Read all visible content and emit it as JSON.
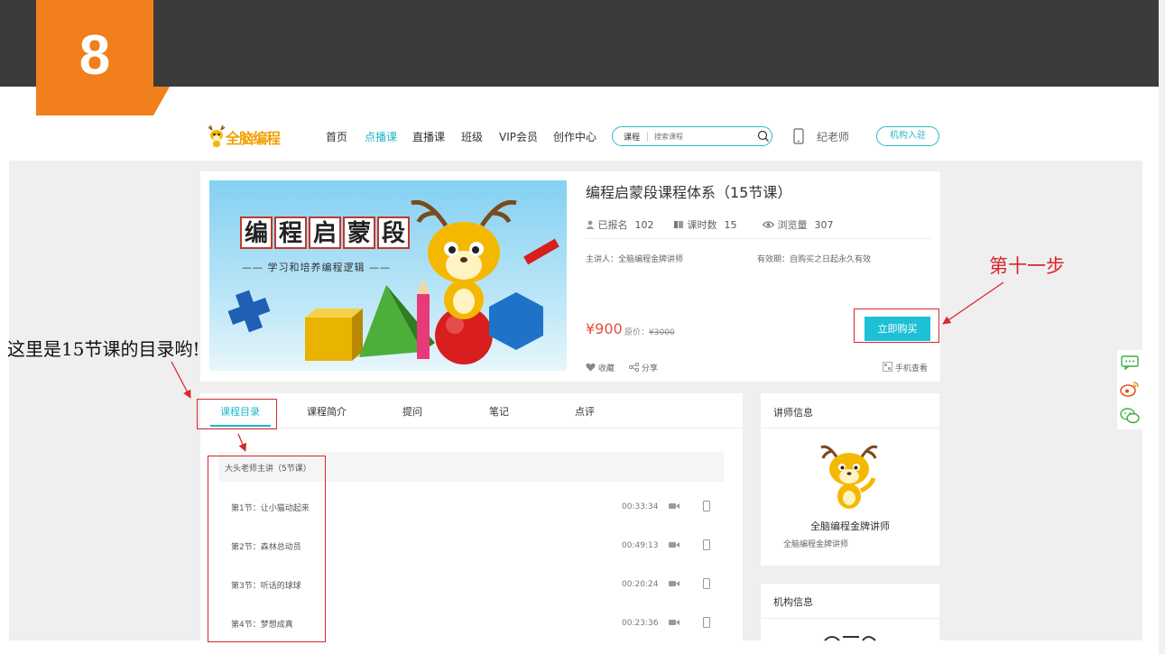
{
  "step": {
    "number": "8"
  },
  "header": {
    "logo_text": "全脑编程",
    "nav": [
      {
        "label": "首页",
        "active": false
      },
      {
        "label": "点播课",
        "active": true
      },
      {
        "label": "直播课",
        "active": false
      },
      {
        "label": "班级",
        "active": false
      },
      {
        "label": "VIP会员",
        "active": false
      },
      {
        "label": "创作中心",
        "active": false
      }
    ],
    "search": {
      "category": "课程",
      "placeholder": "搜索课程"
    },
    "user": "纪老师",
    "org_button": "机构入驻"
  },
  "course": {
    "banner_chars": [
      "编",
      "程",
      "启",
      "蒙",
      "段"
    ],
    "banner_subtitle": "—— 学习和培养编程逻辑 ——",
    "title": "编程启蒙段课程体系（15节课）",
    "stats": [
      {
        "label": "已报名",
        "value": "102"
      },
      {
        "label": "课时数",
        "value": "15"
      },
      {
        "label": "浏览量",
        "value": "307"
      }
    ],
    "lecturer": "主讲人：全脑编程金牌讲师",
    "validity": "有效期：自购买之日起永久有效",
    "price": "¥900",
    "original_label": "原价：",
    "original_price": "¥3000",
    "buy_button": "立即购买",
    "actions": {
      "collect": "收藏",
      "share": "分享",
      "mobile": "手机查看"
    }
  },
  "tabs": [
    "课程目录",
    "课程简介",
    "提问",
    "笔记",
    "点评"
  ],
  "catalog": {
    "section_title": "大头老师主讲（5节课）",
    "lessons": [
      {
        "title": "第1节：让小猫动起来",
        "duration": "00:33:34"
      },
      {
        "title": "第2节：森林总动员",
        "duration": "00:49:13"
      },
      {
        "title": "第3节：听话的球球",
        "duration": "00:20:24"
      },
      {
        "title": "第4节：梦想成真",
        "duration": "00:23:36"
      }
    ]
  },
  "teacher": {
    "heading": "讲师信息",
    "name": "全脑编程金牌讲师",
    "desc": "全脑编程金牌讲师"
  },
  "organization": {
    "heading": "机构信息"
  },
  "annotations": {
    "step_label": "第十一步",
    "catalog_note": "这里是15节课的目录哟!",
    "color": "#d9262b"
  }
}
